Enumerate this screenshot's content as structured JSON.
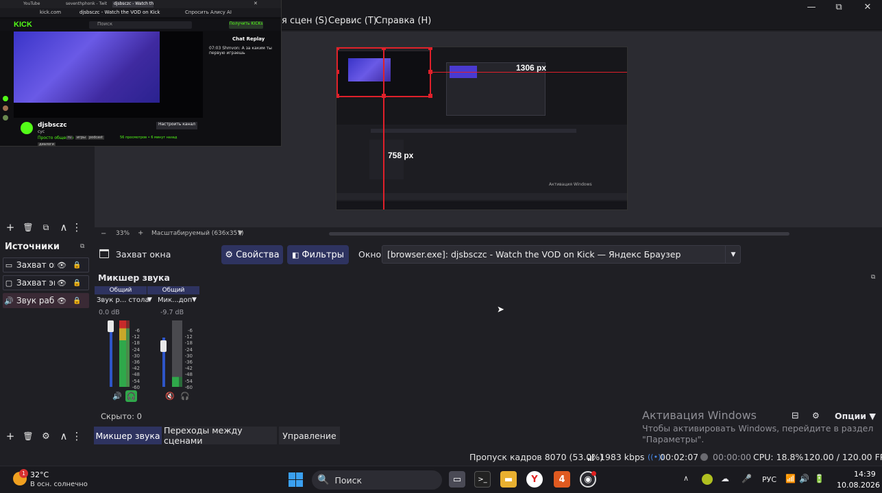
{
  "menu": {
    "partial_item": "я сцен (S)",
    "service": "Сервис (T)",
    "help": "Справка (H)"
  },
  "window_controls": {
    "minimize": "—",
    "maximize": "⧉",
    "close": "✕"
  },
  "browser_overlay": {
    "tabs": [
      "YouTube",
      "seventhphonk - Twitch",
      "djsbsczc - Watch the VOD on Kick",
      "Спросить Алису AI"
    ],
    "url": "kick.com",
    "page_title": "djsbsczc - Watch the VOD on Kick",
    "kick_logo": "KICK",
    "search_placeholder": "Поиск",
    "get_kicks_button": "Получить KICKs",
    "chat_title": "Chat Replay",
    "chat_line": "07:03 Shmvon: А за каким ты первую играешь",
    "streamer_name": "djsbsczc",
    "stream_subtitle": "cyc",
    "category": "Просто общение",
    "tags": [
      "ru",
      "игры",
      "podcast"
    ],
    "viewers": "56 просмотров • 6 минут назад",
    "follow_button": "Настроить канал",
    "extra_badge": "диалоги"
  },
  "preview": {
    "width_label": "1306 px",
    "height_label": "758 px",
    "zoom_minus": "−",
    "zoom_value": "33%",
    "zoom_plus": "+",
    "scale_mode": "Масштабируемый (636x357)",
    "inner_activation": "Активация Windows"
  },
  "scenes_toolbar": {
    "add": "+",
    "remove": "🗑",
    "filters": "⧉",
    "up": "∧",
    "more": "⋮"
  },
  "sources": {
    "title": "Источники",
    "items": [
      {
        "label": "Захват ок",
        "icon": "window-capture-icon"
      },
      {
        "label": "Захват эк",
        "icon": "display-capture-icon"
      },
      {
        "label": "Звук раб.",
        "icon": "audio-output-icon"
      }
    ]
  },
  "sources_toolbar": {
    "add": "+",
    "remove": "🗑",
    "settings": "⚙",
    "up": "∧",
    "more": "⋮"
  },
  "properties_bar": {
    "source_name": "Захват окна",
    "properties_button": "Свойства",
    "filters_button": "Фильтры",
    "window_label": "Окно",
    "window_value": "[browser.exe]: djsbsczc - Watch the VOD on Kick — Яндекс Браузер"
  },
  "mixer": {
    "title": "Микшер звука",
    "strips": [
      {
        "header": "Общий",
        "name": "Звук р... стола",
        "db": "0.0 dB",
        "level": 1.0,
        "monitor_active": true
      },
      {
        "header": "Общий",
        "name": "Мик...доп",
        "db": "-9.7 dB",
        "level": 0.7,
        "monitor_active": false
      }
    ],
    "scale": [
      "-6",
      "-12",
      "-18",
      "-24",
      "-30",
      "-36",
      "-42",
      "-48",
      "-54",
      "-60"
    ],
    "hidden": "Скрыто: 0",
    "options": "Опции",
    "activation_title": "Активация Windows",
    "activation_text_1": "Чтобы активировать Windows, перейдите в раздел",
    "activation_text_2": "\"Параметры\"."
  },
  "bottom_tabs": [
    "Микшер звука",
    "Переходы между сценами",
    "Управление"
  ],
  "status": {
    "dropped_frames": "Пропуск кадров 8070 (53.0%)",
    "bitrate": "1983 kbps",
    "stream_time": "00:02:07",
    "rec_time": "00:00:00",
    "cpu": "CPU: 18.8%",
    "fps": "120.00 / 120.00 FPS"
  },
  "taskbar": {
    "weather_temp": "32°C",
    "weather_desc": "В осн. солнечно",
    "weather_badge": "1",
    "search": "Поиск",
    "language": "РУС",
    "time": "14:39",
    "date": "10.08.2026"
  },
  "colors": {
    "accent": "#2e3360",
    "source_active": "#3a2a35",
    "red": "#e0202a",
    "kick_green": "#53fc18"
  }
}
